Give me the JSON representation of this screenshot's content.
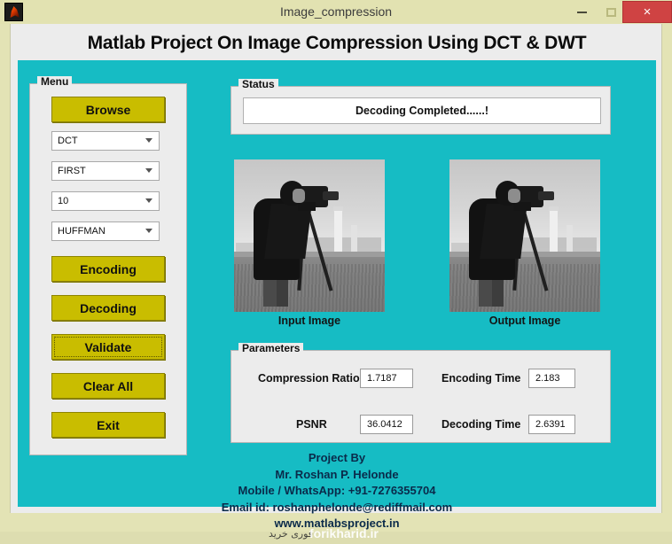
{
  "window": {
    "title": "Image_compression",
    "icon": "matlab-membrane-icon",
    "minimize_label": "",
    "maximize_label": "",
    "close_label": "×"
  },
  "page_title": "Matlab Project On Image Compression Using DCT & DWT",
  "colors": {
    "canvas_teal": "#16bcc4",
    "button_olive": "#c9bd00",
    "panel_gray": "#ececec",
    "titlebar_khaki": "#e2e2b1",
    "close_red": "#cf4343",
    "cursor_green": "#9fd93e",
    "footer_text": "#0a2a4a"
  },
  "menu": {
    "title": "Menu",
    "buttons": [
      {
        "label": "Browse",
        "focused": false
      },
      {
        "label": "Encoding",
        "focused": false
      },
      {
        "label": "Decoding",
        "focused": false
      },
      {
        "label": "Validate",
        "focused": true
      },
      {
        "label": "Clear All",
        "focused": false
      },
      {
        "label": "Exit",
        "focused": false
      }
    ],
    "dropdowns": [
      {
        "name": "transform-select",
        "value": "DCT"
      },
      {
        "name": "level-select",
        "value": "FIRST"
      },
      {
        "name": "quality-select",
        "value": "10"
      },
      {
        "name": "coding-select",
        "value": "HUFFMAN"
      }
    ]
  },
  "status": {
    "title": "Status",
    "message": "Decoding Completed......!"
  },
  "images": {
    "input_label": "Input Image",
    "output_label": "Output Image"
  },
  "parameters": {
    "title": "Parameters",
    "fields": [
      {
        "label": "Compression Ratio",
        "value": "1.7187"
      },
      {
        "label": "Encoding Time",
        "value": "2.183"
      },
      {
        "label": "PSNR",
        "value": "36.0412"
      },
      {
        "label": "Decoding Time",
        "value": "2.6391"
      }
    ]
  },
  "footer": {
    "line1": "Project By",
    "line2": "Mr. Roshan P. Helonde",
    "line3": "Mobile / WhatsApp: +91-7276355704",
    "line4": "Email id: roshanphelonde@rediffmail.com",
    "line5": "www.matlabsproject.in"
  },
  "watermark": {
    "english": "forikharid.ir",
    "persian": "فوری خرید"
  }
}
